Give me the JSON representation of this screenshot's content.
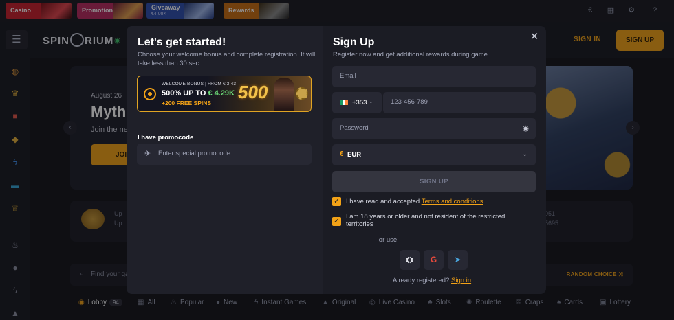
{
  "promos": [
    {
      "label": "Casino"
    },
    {
      "label": "Promotions"
    },
    {
      "label": "Giveaway",
      "sub": "€4.08K"
    },
    {
      "label": "Rewards"
    }
  ],
  "header": {
    "sign_in": "SIGN IN",
    "sign_up": "SIGN UP",
    "logo_left": "SPIN",
    "logo_right": "RIUM"
  },
  "banner": {
    "date": "August 26",
    "title": "Myth",
    "desc": "Join the ne",
    "join": "JOI"
  },
  "stats": {
    "a": "Up",
    "b": "Up",
    "c": "051",
    "d": "5695"
  },
  "search": {
    "placeholder": "Find your ga",
    "random": "RANDOM CHOICE"
  },
  "categories": [
    {
      "label": "Lobby",
      "badge": "94"
    },
    {
      "label": "All"
    },
    {
      "label": "Popular"
    },
    {
      "label": "New"
    },
    {
      "label": "Instant Games"
    },
    {
      "label": "Original"
    },
    {
      "label": "Live Casino"
    },
    {
      "label": "Slots"
    },
    {
      "label": "Roulette"
    },
    {
      "label": "Craps"
    },
    {
      "label": "Cards"
    },
    {
      "label": "Lottery"
    }
  ],
  "modal": {
    "left_title": "Let's get started!",
    "left_lead": "Choose your welcome bonus and complete registration. It will take less than 30 sec.",
    "bonus": {
      "top": "WELCOME BONUS | FROM € 3.43",
      "main_prefix": "500% UP TO ",
      "main_amount": "€ 4.29K",
      "spins": "+200 FREE SPINS",
      "big": "500"
    },
    "promocode_label": "I have promocode",
    "promocode_placeholder": "Enter special promocode",
    "right_title": "Sign Up",
    "right_lead": "Register now and get additional rewards during game",
    "email_placeholder": "Email",
    "country_code": "+353",
    "phone_placeholder": "123-456-789",
    "password_placeholder": "Password",
    "currency_symbol": "€",
    "currency": "EUR",
    "submit": "SIGN UP",
    "check1_text": "I have read and accepted ",
    "check1_link": "Terms and conditions",
    "check2_text": "I am 18 years or older and not resident of the restricted territories",
    "or_use": "or use",
    "already": "Already registered?",
    "sign_in_link": "Sign in"
  }
}
